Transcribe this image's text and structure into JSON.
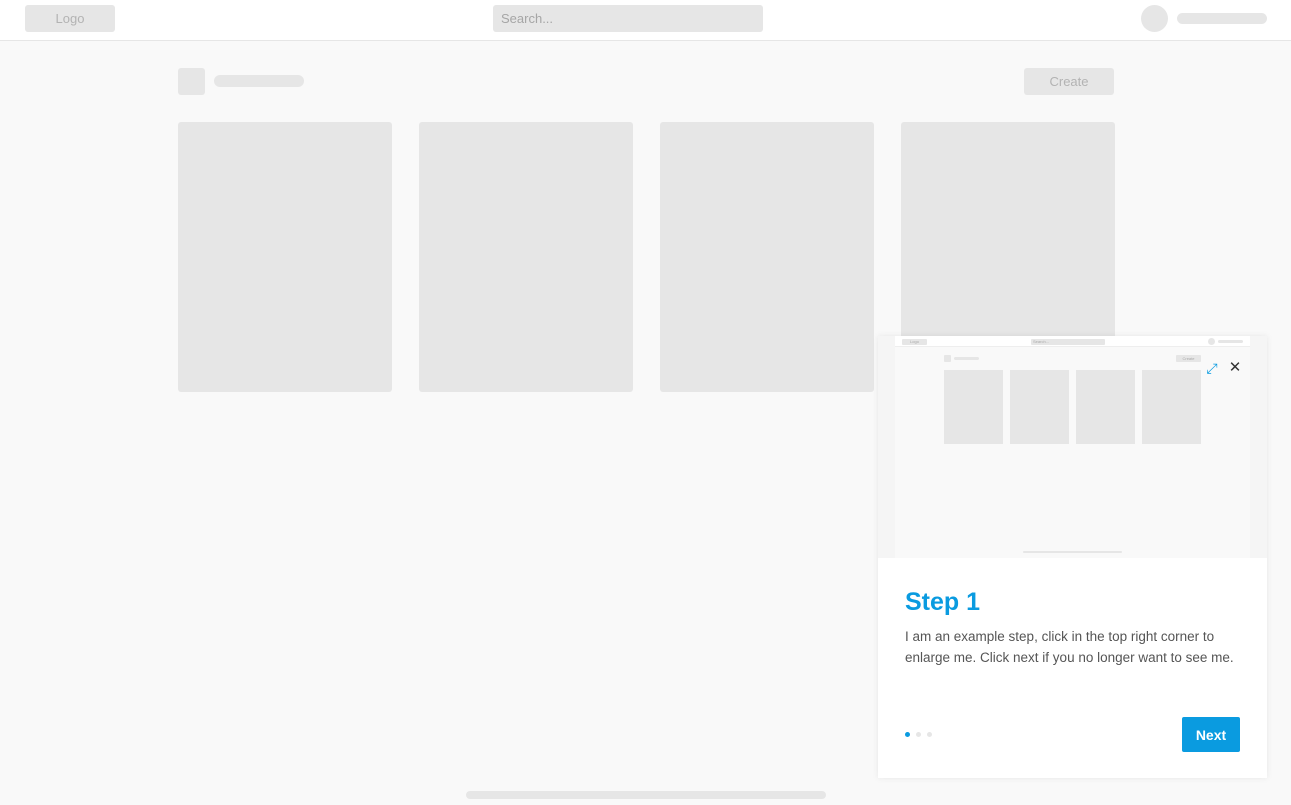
{
  "header": {
    "logo_label": "Logo",
    "search_placeholder": "Search..."
  },
  "toolbar": {
    "create_label": "Create"
  },
  "cards": [
    {
      "id": "card-1"
    },
    {
      "id": "card-2"
    },
    {
      "id": "card-3"
    },
    {
      "id": "card-4"
    }
  ],
  "tour": {
    "preview": {
      "logo_label": "Logo",
      "search_label": "Search...",
      "create_label": "Create"
    },
    "expand_icon": "⤢",
    "close_icon": "✕",
    "step_title": "Step 1",
    "step_text": "I am an example step, click in the top right corner to enlarge me. Click next if you no longer want to see me.",
    "total_steps": 3,
    "current_step": 1,
    "next_label": "Next",
    "accent_color": "#0a9be0"
  }
}
